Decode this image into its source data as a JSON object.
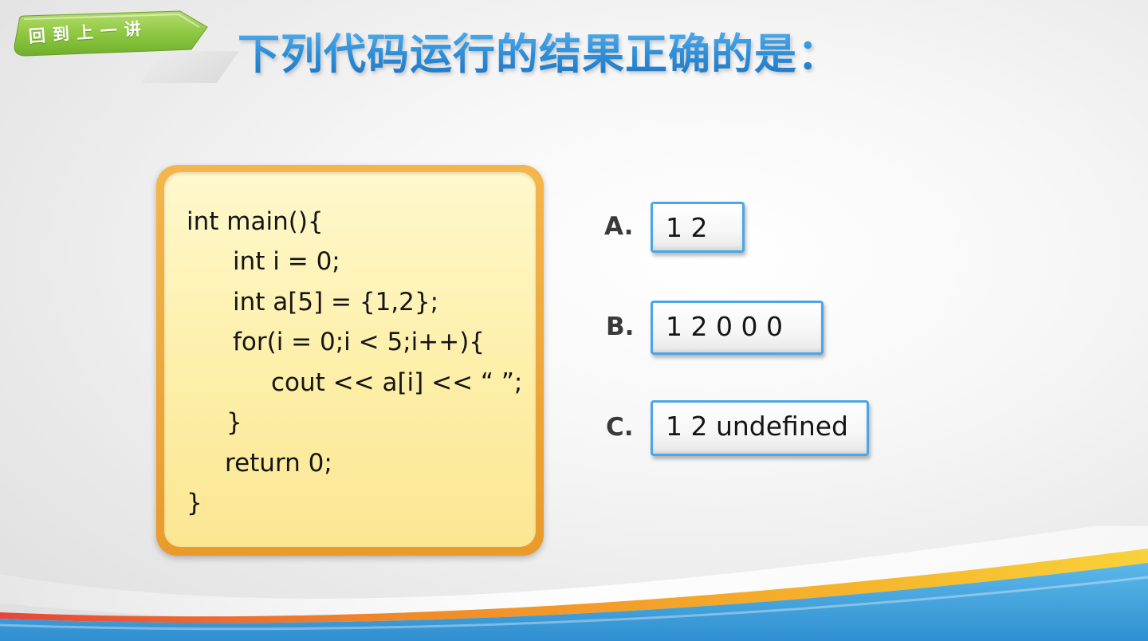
{
  "slide": {
    "back_button_label": "回到上一讲",
    "title": "下列代码运行的结果正确的是：",
    "code_lines": [
      "int main(){",
      "int i = 0;",
      "int a[5] = {1,2};",
      "for(i = 0;i < 5;i++){",
      "cout << a[i] << “ ”;",
      "}",
      "return 0;",
      "}"
    ],
    "options": [
      {
        "letter": "A.",
        "text": "1 2"
      },
      {
        "letter": "B.",
        "text": "1 2 0 0 0"
      },
      {
        "letter": "C.",
        "text": "1 2 undefined"
      }
    ]
  },
  "colors": {
    "title_blue": "#2c8fd9",
    "back_button_green": "#8cc63f",
    "code_border_orange": "#eca234",
    "code_fill_yellow": "#fdf0ad",
    "option_border_blue": "#4aa6e4"
  },
  "icons": [
    "arrow-shape-icon"
  ]
}
